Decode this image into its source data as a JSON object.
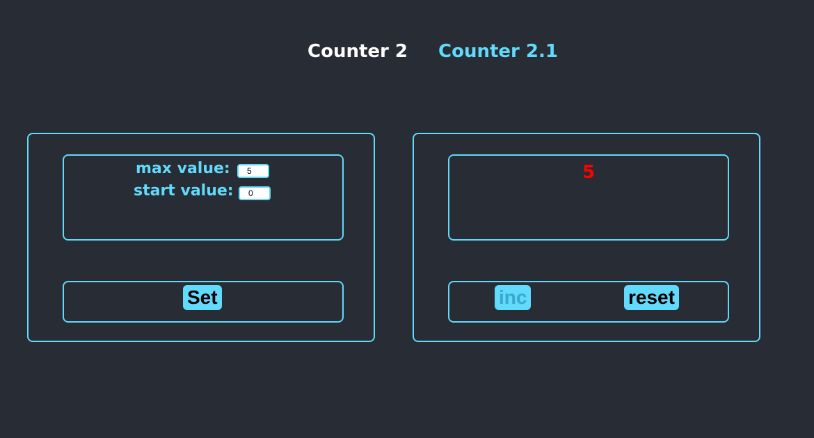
{
  "nav": {
    "links": [
      {
        "label": "Counter 2",
        "active": true
      },
      {
        "label": "Counter 2.1",
        "active": false
      }
    ]
  },
  "settings": {
    "max_label": "max value:",
    "max_value": "5",
    "start_label": "start value:",
    "start_value": "0",
    "set_label": "Set"
  },
  "counter": {
    "value": "5",
    "inc_label": "inc",
    "inc_disabled": true,
    "reset_label": "reset"
  },
  "colors": {
    "background": "#282c34",
    "accent": "#61dafb",
    "limit_value": "#ff0000",
    "active_nav": "#ffffff"
  }
}
